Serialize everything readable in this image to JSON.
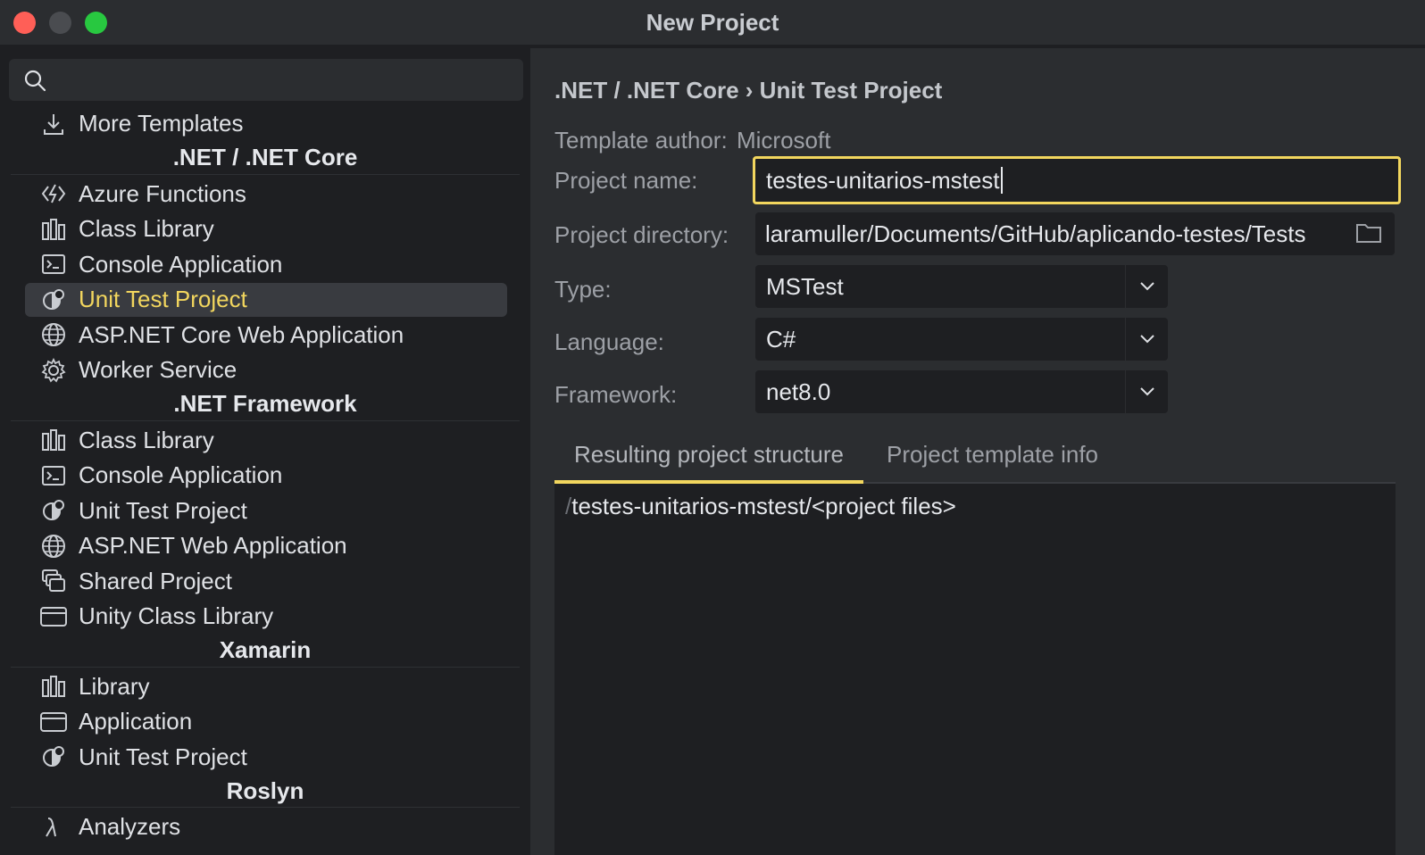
{
  "window": {
    "title": "New Project"
  },
  "search": {
    "placeholder": "",
    "value": ""
  },
  "sidebar": {
    "more_templates": {
      "label": "More Templates",
      "icon": "download-icon"
    },
    "groups": [
      {
        "title": ".NET / .NET Core",
        "items": [
          {
            "label": "Azure Functions",
            "icon": "azure-functions-icon"
          },
          {
            "label": "Class Library",
            "icon": "class-library-icon"
          },
          {
            "label": "Console Application",
            "icon": "console-icon"
          },
          {
            "label": "Unit Test Project",
            "icon": "unit-test-icon",
            "selected": true
          },
          {
            "label": "ASP.NET Core Web Application",
            "icon": "globe-icon"
          },
          {
            "label": "Worker Service",
            "icon": "gear-icon"
          }
        ]
      },
      {
        "title": ".NET Framework",
        "items": [
          {
            "label": "Class Library",
            "icon": "class-library-icon"
          },
          {
            "label": "Console Application",
            "icon": "console-icon"
          },
          {
            "label": "Unit Test Project",
            "icon": "unit-test-icon"
          },
          {
            "label": "ASP.NET Web Application",
            "icon": "globe-icon"
          },
          {
            "label": "Shared Project",
            "icon": "shared-project-icon"
          },
          {
            "label": "Unity Class Library",
            "icon": "window-icon"
          }
        ]
      },
      {
        "title": "Xamarin",
        "items": [
          {
            "label": "Library",
            "icon": "class-library-icon"
          },
          {
            "label": "Application",
            "icon": "window-icon"
          },
          {
            "label": "Unit Test Project",
            "icon": "unit-test-icon"
          }
        ]
      },
      {
        "title": "Roslyn",
        "items": [
          {
            "label": "Analyzers",
            "icon": "analyzer-icon"
          }
        ]
      }
    ]
  },
  "main": {
    "breadcrumb": ".NET / .NET Core › Unit Test Project",
    "template_author_label": "Template author:",
    "template_author": "Microsoft",
    "project_name_label": "Project name:",
    "project_name": "testes-unitarios-mstest",
    "project_directory_label": "Project directory:",
    "project_directory": "laramuller/Documents/GitHub/aplicando-testes/Tests",
    "type_label": "Type:",
    "type": "MSTest",
    "language_label": "Language:",
    "language": "C#",
    "framework_label": "Framework:",
    "framework": "net8.0",
    "tabs": [
      {
        "label": "Resulting project structure",
        "active": true
      },
      {
        "label": "Project template info",
        "active": false
      }
    ],
    "structure_prefix": "/",
    "structure_line": "testes-unitarios-mstest/<project files>"
  },
  "colors": {
    "accent": "#f2d65e",
    "background": "#1e1f22",
    "panel": "#2b2d30"
  }
}
